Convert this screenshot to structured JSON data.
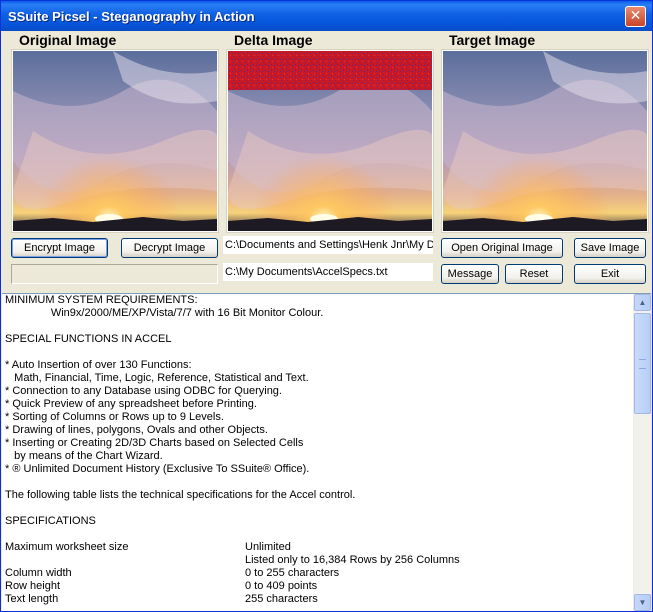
{
  "window": {
    "title": "SSuite Picsel - Steganography in Action"
  },
  "panels": {
    "original": {
      "title": "Original Image"
    },
    "delta": {
      "title": "Delta Image"
    },
    "target": {
      "title": "Target Image"
    }
  },
  "buttons": {
    "encrypt": "Encrypt Image",
    "decrypt": "Decrypt Image",
    "open_original": "Open Original Image",
    "save": "Save Image",
    "message": "Message",
    "reset": "Reset",
    "exit": "Exit"
  },
  "fields": {
    "image_path": "C:\\Documents and Settings\\Henk Jnr\\My D",
    "text_path": "C:\\My Documents\\AccelSpecs.txt"
  },
  "memo": {
    "lines": [
      "MINIMUM SYSTEM REQUIREMENTS:",
      "               Win9x/2000/ME/XP/Vista/7/7 with 16 Bit Monitor Colour.",
      "",
      "SPECIAL FUNCTIONS IN ACCEL",
      "",
      "* Auto Insertion of over 130 Functions:",
      "   Math, Financial, Time, Logic, Reference, Statistical and Text.",
      "* Connection to any Database using ODBC for Querying.",
      "* Quick Preview of any spreadsheet before Printing.",
      "* Sorting of Columns or Rows up to 9 Levels.",
      "* Drawing of lines, polygons, Ovals and other Objects.",
      "* Inserting or Creating 2D/3D Charts based on Selected Cells",
      "   by means of the Chart Wizard.",
      "* ® Unlimited Document History (Exclusive To SSuite® Office).",
      "",
      "The following table lists the technical specifications for the Accel control.",
      "",
      "SPECIFICATIONS",
      ""
    ],
    "specs": [
      {
        "key": "Maximum worksheet size",
        "value": "Unlimited"
      },
      {
        "key": "",
        "value": "Listed only to 16,384 Rows by 256 Columns"
      },
      {
        "key": "Column width",
        "value": "0 to 255 characters"
      },
      {
        "key": "Row height",
        "value": "0 to 409 points"
      },
      {
        "key": "Text length",
        "value": "255 characters"
      }
    ]
  },
  "icons": {
    "close": "close-icon",
    "scroll_up": "scroll-up-arrow-icon",
    "scroll_down": "scroll-down-arrow-icon"
  },
  "colors": {
    "titlebar": "#0A5CEA",
    "window_bg": "#ECE9D8",
    "close_button": "#D5593A"
  }
}
